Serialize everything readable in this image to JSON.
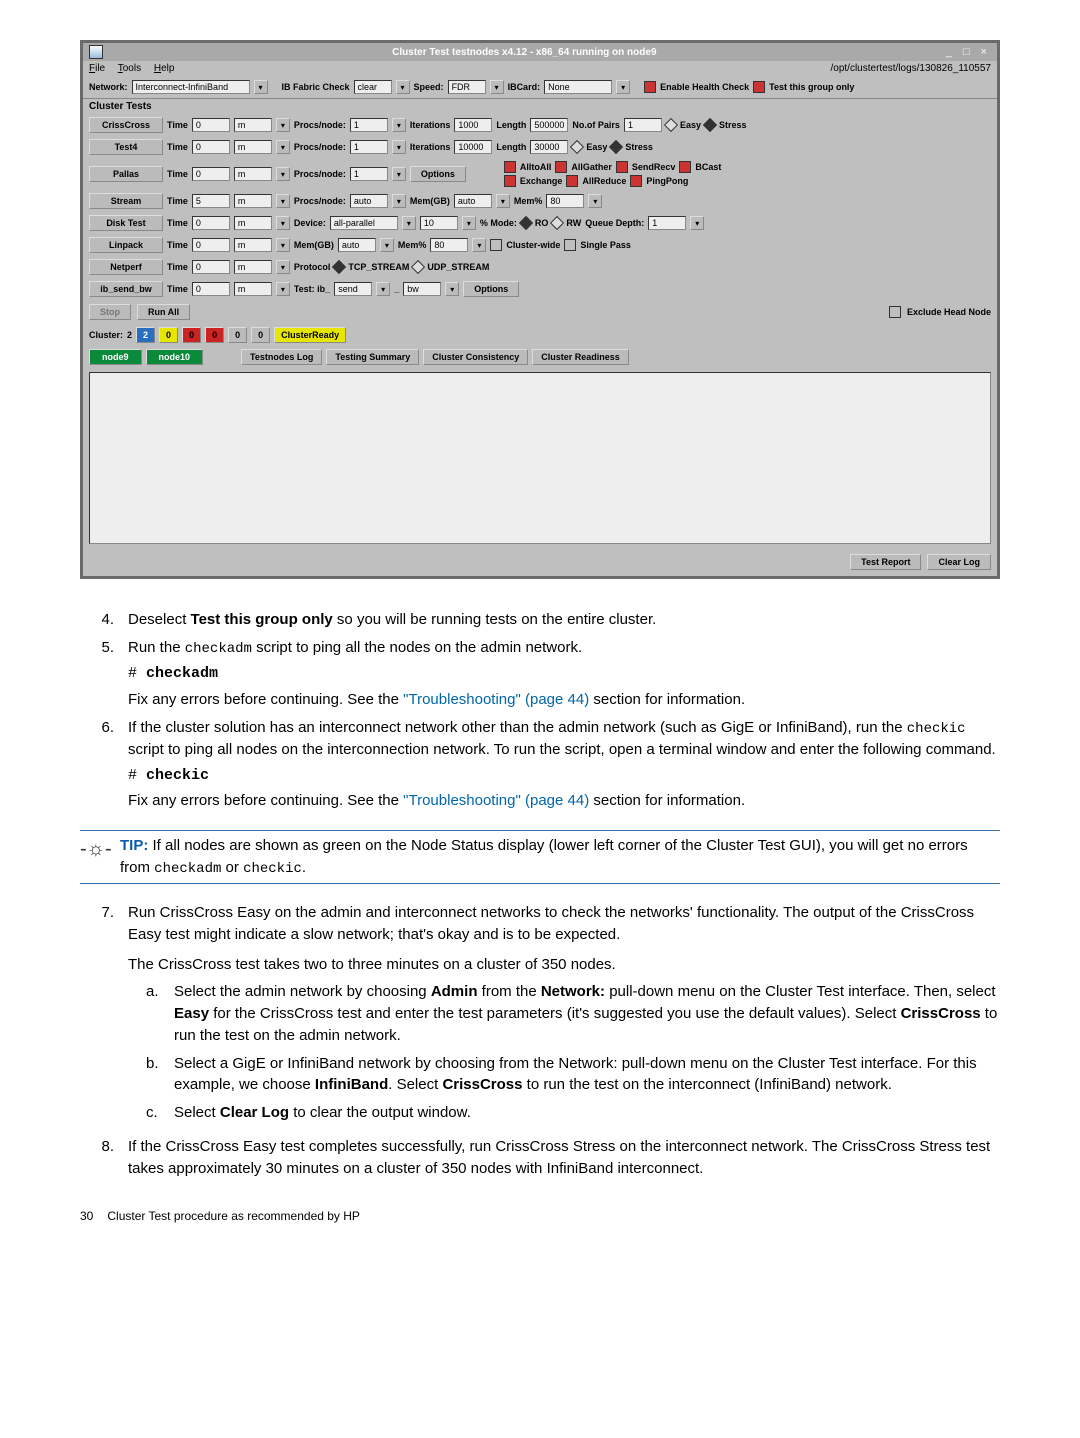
{
  "screenshot": {
    "title": "Cluster Test testnodes x4.12  -  x86_64 running on node9",
    "path": "/opt/clustertest/logs/130826_110557",
    "menu": {
      "file": "File",
      "tools": "Tools",
      "help": "Help"
    },
    "toolbar": {
      "network_lbl": "Network:",
      "network_val": "Interconnect-InfiniBand",
      "fabric_lbl": "IB Fabric Check",
      "fabric_val": "clear",
      "speed_lbl": "Speed:",
      "speed_val": "FDR",
      "ibcard_lbl": "IBCard:",
      "ibcard_val": "None",
      "health_lbl": "Enable Health Check",
      "group_lbl": "Test this group only"
    },
    "cluster_tests_header": "Cluster Tests",
    "tests": {
      "crisscross": {
        "btn": "CrissCross",
        "time_lbl": "Time",
        "time_val": "0",
        "unit": "m",
        "procs_lbl": "Procs/node:",
        "procs_val": "1",
        "iters_lbl": "Iterations",
        "iters_val": "1000",
        "len_lbl": "Length",
        "len_val": "500000",
        "pairs_lbl": "No.of Pairs",
        "pairs_val": "1",
        "easy": "Easy",
        "stress": "Stress"
      },
      "test4": {
        "btn": "Test4",
        "time_lbl": "Time",
        "time_val": "0",
        "unit": "m",
        "procs_lbl": "Procs/node:",
        "procs_val": "1",
        "iters_lbl": "Iterations",
        "iters_val": "10000",
        "len_lbl": "Length",
        "len_val": "30000",
        "easy": "Easy",
        "stress": "Stress"
      },
      "pallas": {
        "btn": "Pallas",
        "time_lbl": "Time",
        "time_val": "0",
        "unit": "m",
        "procs_lbl": "Procs/node:",
        "procs_val": "1",
        "options": "Options",
        "alltoall": "AlltoAll",
        "allgather": "AllGather",
        "sendrecv": "SendRecv",
        "bcast": "BCast",
        "exchange": "Exchange",
        "allreduce": "AllReduce",
        "pingpong": "PingPong"
      },
      "stream": {
        "btn": "Stream",
        "time_lbl": "Time",
        "time_val": "5",
        "unit": "m",
        "procs_lbl": "Procs/node:",
        "procs_val": "auto",
        "memgb_lbl": "Mem(GB)",
        "memgb_val": "auto",
        "mempct_lbl": "Mem%",
        "mempct_val": "80"
      },
      "disk": {
        "btn": "Disk Test",
        "time_lbl": "Time",
        "time_val": "0",
        "unit": "m",
        "device_lbl": "Device:",
        "device_val": "all-parallel",
        "ten": "10",
        "pct": "% Mode:",
        "ro": "RO",
        "rw": "RW",
        "queue_lbl": "Queue Depth:",
        "queue_val": "1"
      },
      "linpack": {
        "btn": "Linpack",
        "time_lbl": "Time",
        "time_val": "0",
        "unit": "m",
        "memgb_lbl": "Mem(GB)",
        "memgb_val": "auto",
        "mempct_lbl": "Mem%",
        "mempct_val": "80",
        "cluster_wide": "Cluster-wide",
        "single_pass": "Single Pass"
      },
      "netperf": {
        "btn": "Netperf",
        "time_lbl": "Time",
        "time_val": "0",
        "unit": "m",
        "proto_lbl": "Protocol",
        "tcp": "TCP_STREAM",
        "udp": "UDP_STREAM"
      },
      "ib_send_bw": {
        "btn": "ib_send_bw",
        "time_lbl": "Time",
        "time_val": "0",
        "unit": "m",
        "test_lbl": "Test: ib_",
        "test_val1": "send",
        "underscore": "_",
        "test_val2": "bw",
        "options": "Options"
      }
    },
    "runrow": {
      "stop": "Stop",
      "runall": "Run All",
      "exclude": "Exclude Head Node"
    },
    "clusterrow": {
      "lbl": "Cluster:",
      "total": "2",
      "v_blue": "2",
      "v_y1": "0",
      "v_r1": "0",
      "v_r2": "0",
      "v_g1": "0",
      "v_g2": "0",
      "ready": "ClusterReady"
    },
    "nodesrow": {
      "node9": "node9",
      "node10": "node10",
      "tlog": "Testnodes Log",
      "tsummary": "Testing Summary",
      "ccons": "Cluster Consistency",
      "creadiness": "Cluster Readiness"
    },
    "footer": {
      "test_report": "Test Report",
      "clear_log": "Clear Log"
    }
  },
  "steps": {
    "s4": {
      "num": "4.",
      "text_pre": "Deselect ",
      "bold": "Test this group only",
      "text_post": " so you will be running tests on the entire cluster."
    },
    "s5": {
      "num": "5.",
      "text_pre": "Run the ",
      "mono": "checkadm",
      "text_post": " script to ping all the nodes on the admin network.",
      "cmd_hash": "# ",
      "cmd": "checkadm",
      "fix_pre": "Fix any errors before continuing. See the ",
      "link": "\"Troubleshooting\" (page 44)",
      "fix_post": " section for information."
    },
    "s6": {
      "num": "6.",
      "para": "If the cluster solution has an interconnect network other than the admin network (such as GigE or InfiniBand), run the ",
      "mono": "checkic",
      "para2": " script to ping all nodes on the interconnection network. To run the script, open a terminal window and enter the following command.",
      "cmd_hash": "# ",
      "cmd": "checkic",
      "fix_pre": "Fix any errors before continuing. See the ",
      "link": "\"Troubleshooting\" (page 44)",
      "fix_post": " section for information."
    },
    "tip": {
      "label": "TIP:",
      "text_pre": "    If all nodes are shown as green on the Node Status display (lower left corner of the Cluster Test GUI), you will get no errors from ",
      "m1": "checkadm",
      "or": " or ",
      "m2": "checkic",
      "dot": "."
    },
    "s7": {
      "num": "7.",
      "p1": "Run CrissCross Easy on the admin and interconnect networks to check the networks' functionality. The output of the CrissCross Easy test might indicate a slow network; that's okay and is to be expected.",
      "p2": "The CrissCross test takes two to three minutes on a cluster of 350 nodes.",
      "a": {
        "l": "a.",
        "t1": "Select the admin network by choosing ",
        "b1": "Admin",
        "t2": " from the ",
        "b2": "Network:",
        "t3": " pull-down menu on the Cluster Test interface. Then, select ",
        "b3": "Easy",
        "t4": " for the CrissCross test and enter the test parameters (it's suggested you use the default values). Select ",
        "b4": "CrissCross",
        "t5": " to run the test on the admin network."
      },
      "b": {
        "l": "b.",
        "t1": "Select a GigE or InfiniBand network by choosing from the Network: pull-down menu on the Cluster Test interface. For this example, we choose ",
        "b1": "InfiniBand",
        "t2": ". Select ",
        "b2": "CrissCross",
        "t3": " to run the test on the interconnect (InfiniBand) network."
      },
      "c": {
        "l": "c.",
        "t1": "Select ",
        "b1": "Clear Log",
        "t2": " to clear the output window."
      }
    },
    "s8": {
      "num": "8.",
      "text": "If the CrissCross Easy test completes successfully, run CrissCross Stress on the interconnect network. The CrissCross Stress test takes approximately 30 minutes on a cluster of 350 nodes with InfiniBand interconnect."
    }
  },
  "page_footer": {
    "num": "30",
    "text": "Cluster Test procedure as recommended by HP"
  }
}
